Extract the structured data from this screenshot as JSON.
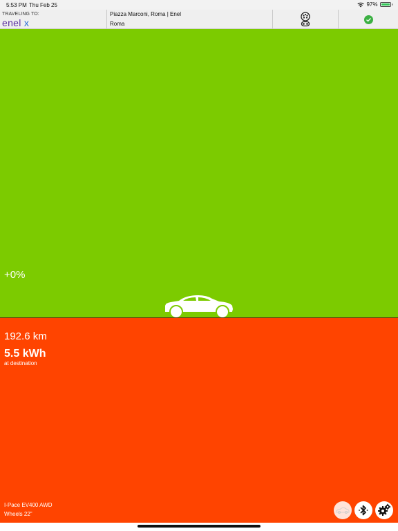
{
  "status_bar": {
    "time": "5:53 PM",
    "date": "Thu Feb 25",
    "battery_percent_text": "97%",
    "battery_level": 0.97,
    "icons": [
      "wifi-icon",
      "battery-icon"
    ]
  },
  "header": {
    "traveling_label": "TRAVELING TO:",
    "brand_main": "enel",
    "brand_x": "x",
    "destination_name": "Piazza Marconi, Roma | Enel",
    "destination_city": "Roma",
    "connector_icon": "connector-plug-icon",
    "status_icon": "check-circle-icon",
    "status_color": "#3cb043"
  },
  "main": {
    "charge_delta": "+0%",
    "top_color": "#7ccb00",
    "bottom_color": "#ff4400",
    "distance": "192.6 km",
    "energy": "5.5 kWh",
    "energy_caption": "at destination",
    "vehicle_model": "I-Pace EV400 AWD",
    "wheels": "Wheels 22\""
  },
  "actions": [
    {
      "name": "vehicle-button",
      "icon": "car-outline-icon"
    },
    {
      "name": "bluetooth-button",
      "icon": "bluetooth-icon"
    },
    {
      "name": "settings-button",
      "icon": "gears-icon"
    }
  ]
}
